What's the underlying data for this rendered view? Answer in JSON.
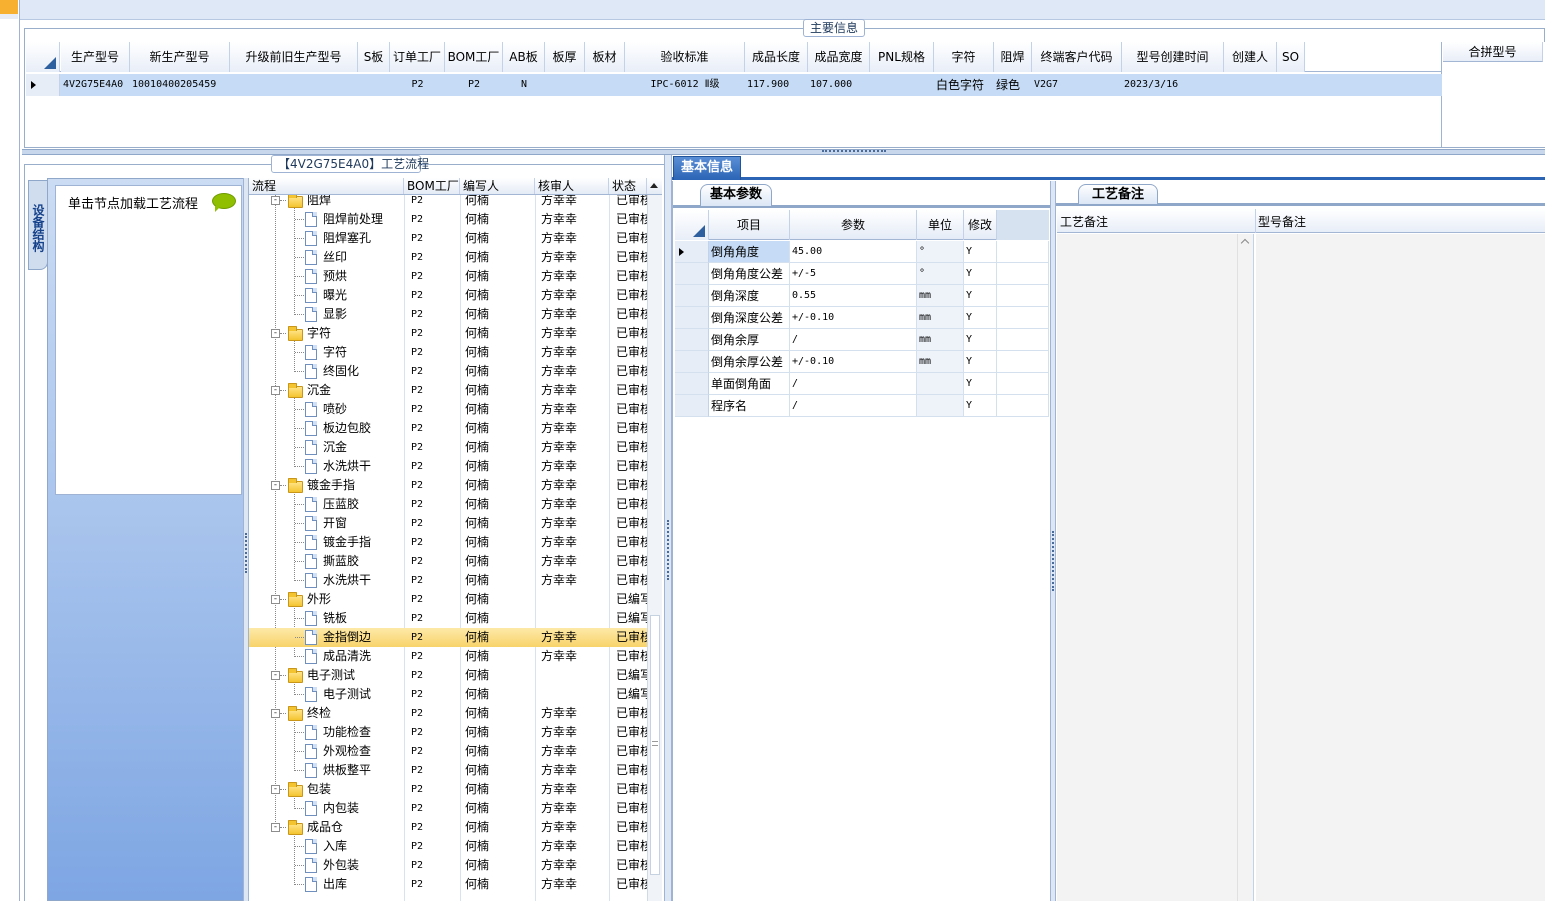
{
  "main_info": {
    "title": "主要信息",
    "columns": [
      "生产型号",
      "新生产型号",
      "升级前旧生产型号",
      "S板",
      "订单工厂",
      "BOM工厂",
      "AB板",
      "板厚",
      "板材",
      "验收标准",
      "成品长度",
      "成品宽度",
      "PNL规格",
      "字符",
      "阻焊",
      "终端客户代码",
      "型号创建时间",
      "创建人",
      "SO"
    ],
    "row": [
      "4V2G75E4A0",
      "10010400205459",
      "",
      "",
      "P2",
      "P2",
      "N",
      "",
      "",
      "IPC-6012 Ⅱ级",
      "117.900",
      "107.000",
      "",
      "白色字符",
      "绿色",
      "V2G7",
      "2023/3/16",
      "",
      ""
    ],
    "side_header": "合拼型号"
  },
  "left_tab": {
    "label": "设备结构"
  },
  "hint": {
    "text": "单击节点加载工艺流程"
  },
  "process": {
    "title": "【4V2G75E4A0】工艺流程",
    "columns": [
      "流程",
      "BOM工厂",
      "编写人",
      "核审人",
      "状态"
    ],
    "rows": [
      {
        "level": 0,
        "type": "folder",
        "name": "阻焊",
        "bom": "P2",
        "writer": "何楠",
        "reviewer": "方幸幸",
        "status": "已审核"
      },
      {
        "level": 1,
        "type": "doc",
        "name": "阻焊前处理",
        "bom": "P2",
        "writer": "何楠",
        "reviewer": "方幸幸",
        "status": "已审核"
      },
      {
        "level": 1,
        "type": "doc",
        "name": "阻焊塞孔",
        "bom": "P2",
        "writer": "何楠",
        "reviewer": "方幸幸",
        "status": "已审核"
      },
      {
        "level": 1,
        "type": "doc",
        "name": "丝印",
        "bom": "P2",
        "writer": "何楠",
        "reviewer": "方幸幸",
        "status": "已审核"
      },
      {
        "level": 1,
        "type": "doc",
        "name": "预烘",
        "bom": "P2",
        "writer": "何楠",
        "reviewer": "方幸幸",
        "status": "已审核"
      },
      {
        "level": 1,
        "type": "doc",
        "name": "曝光",
        "bom": "P2",
        "writer": "何楠",
        "reviewer": "方幸幸",
        "status": "已审核"
      },
      {
        "level": 1,
        "type": "doc",
        "name": "显影",
        "bom": "P2",
        "writer": "何楠",
        "reviewer": "方幸幸",
        "status": "已审核"
      },
      {
        "level": 0,
        "type": "folder",
        "name": "字符",
        "bom": "P2",
        "writer": "何楠",
        "reviewer": "方幸幸",
        "status": "已审核"
      },
      {
        "level": 1,
        "type": "doc",
        "name": "字符",
        "bom": "P2",
        "writer": "何楠",
        "reviewer": "方幸幸",
        "status": "已审核"
      },
      {
        "level": 1,
        "type": "doc",
        "name": "终固化",
        "bom": "P2",
        "writer": "何楠",
        "reviewer": "方幸幸",
        "status": "已审核"
      },
      {
        "level": 0,
        "type": "folder",
        "name": "沉金",
        "bom": "P2",
        "writer": "何楠",
        "reviewer": "方幸幸",
        "status": "已审核"
      },
      {
        "level": 1,
        "type": "doc",
        "name": "喷砂",
        "bom": "P2",
        "writer": "何楠",
        "reviewer": "方幸幸",
        "status": "已审核"
      },
      {
        "level": 1,
        "type": "doc",
        "name": "板边包胶",
        "bom": "P2",
        "writer": "何楠",
        "reviewer": "方幸幸",
        "status": "已审核"
      },
      {
        "level": 1,
        "type": "doc",
        "name": "沉金",
        "bom": "P2",
        "writer": "何楠",
        "reviewer": "方幸幸",
        "status": "已审核"
      },
      {
        "level": 1,
        "type": "doc",
        "name": "水洗烘干",
        "bom": "P2",
        "writer": "何楠",
        "reviewer": "方幸幸",
        "status": "已审核"
      },
      {
        "level": 0,
        "type": "folder",
        "name": "镀金手指",
        "bom": "P2",
        "writer": "何楠",
        "reviewer": "方幸幸",
        "status": "已审核"
      },
      {
        "level": 1,
        "type": "doc",
        "name": "压蓝胶",
        "bom": "P2",
        "writer": "何楠",
        "reviewer": "方幸幸",
        "status": "已审核"
      },
      {
        "level": 1,
        "type": "doc",
        "name": "开窗",
        "bom": "P2",
        "writer": "何楠",
        "reviewer": "方幸幸",
        "status": "已审核"
      },
      {
        "level": 1,
        "type": "doc",
        "name": "镀金手指",
        "bom": "P2",
        "writer": "何楠",
        "reviewer": "方幸幸",
        "status": "已审核"
      },
      {
        "level": 1,
        "type": "doc",
        "name": "撕蓝胶",
        "bom": "P2",
        "writer": "何楠",
        "reviewer": "方幸幸",
        "status": "已审核"
      },
      {
        "level": 1,
        "type": "doc",
        "name": "水洗烘干",
        "bom": "P2",
        "writer": "何楠",
        "reviewer": "方幸幸",
        "status": "已审核"
      },
      {
        "level": 0,
        "type": "folder",
        "name": "外形",
        "bom": "P2",
        "writer": "何楠",
        "reviewer": "",
        "status": "已编写"
      },
      {
        "level": 1,
        "type": "doc",
        "name": "铣板",
        "bom": "P2",
        "writer": "何楠",
        "reviewer": "",
        "status": "已编写"
      },
      {
        "level": 1,
        "type": "doc",
        "name": "金指倒边",
        "bom": "P2",
        "writer": "何楠",
        "reviewer": "方幸幸",
        "status": "已审核",
        "selected": true
      },
      {
        "level": 1,
        "type": "doc",
        "name": "成品清洗",
        "bom": "P2",
        "writer": "何楠",
        "reviewer": "方幸幸",
        "status": "已审核"
      },
      {
        "level": 0,
        "type": "folder",
        "name": "电子测试",
        "bom": "P2",
        "writer": "何楠",
        "reviewer": "",
        "status": "已编写"
      },
      {
        "level": 1,
        "type": "doc",
        "name": "电子测试",
        "bom": "P2",
        "writer": "何楠",
        "reviewer": "",
        "status": "已编写"
      },
      {
        "level": 0,
        "type": "folder",
        "name": "终检",
        "bom": "P2",
        "writer": "何楠",
        "reviewer": "方幸幸",
        "status": "已审核"
      },
      {
        "level": 1,
        "type": "doc",
        "name": "功能检查",
        "bom": "P2",
        "writer": "何楠",
        "reviewer": "方幸幸",
        "status": "已审核"
      },
      {
        "level": 1,
        "type": "doc",
        "name": "外观检查",
        "bom": "P2",
        "writer": "何楠",
        "reviewer": "方幸幸",
        "status": "已审核"
      },
      {
        "level": 1,
        "type": "doc",
        "name": "烘板整平",
        "bom": "P2",
        "writer": "何楠",
        "reviewer": "方幸幸",
        "status": "已审核"
      },
      {
        "level": 0,
        "type": "folder",
        "name": "包装",
        "bom": "P2",
        "writer": "何楠",
        "reviewer": "方幸幸",
        "status": "已审核"
      },
      {
        "level": 1,
        "type": "doc",
        "name": "内包装",
        "bom": "P2",
        "writer": "何楠",
        "reviewer": "方幸幸",
        "status": "已审核"
      },
      {
        "level": 0,
        "type": "folder",
        "name": "成品仓",
        "bom": "P2",
        "writer": "何楠",
        "reviewer": "方幸幸",
        "status": "已审核"
      },
      {
        "level": 1,
        "type": "doc",
        "name": "入库",
        "bom": "P2",
        "writer": "何楠",
        "reviewer": "方幸幸",
        "status": "已审核"
      },
      {
        "level": 1,
        "type": "doc",
        "name": "外包装",
        "bom": "P2",
        "writer": "何楠",
        "reviewer": "方幸幸",
        "status": "已审核"
      },
      {
        "level": 1,
        "type": "doc",
        "name": "出库",
        "bom": "P2",
        "writer": "何楠",
        "reviewer": "方幸幸",
        "status": "已审核"
      }
    ]
  },
  "basic_info": {
    "tab": "基本信息",
    "subtab": "基本参数",
    "columns": [
      "项目",
      "参数",
      "单位",
      "修改"
    ],
    "rows": [
      [
        "倒角角度",
        "45.00",
        "°",
        "Y"
      ],
      [
        "倒角角度公差",
        "+/-5",
        "°",
        "Y"
      ],
      [
        "倒角深度",
        "0.55",
        "mm",
        "Y"
      ],
      [
        "倒角深度公差",
        "+/-0.10",
        "mm",
        "Y"
      ],
      [
        "倒角余厚",
        "/",
        "mm",
        "Y"
      ],
      [
        "倒角余厚公差",
        "+/-0.10",
        "mm",
        "Y"
      ],
      [
        "单面倒角面",
        "/",
        "",
        "Y"
      ],
      [
        "程序名",
        "/",
        "",
        "Y"
      ]
    ]
  },
  "craft_notes": {
    "tab": "工艺备注",
    "col1": "工艺备注",
    "col2": "型号备注"
  }
}
